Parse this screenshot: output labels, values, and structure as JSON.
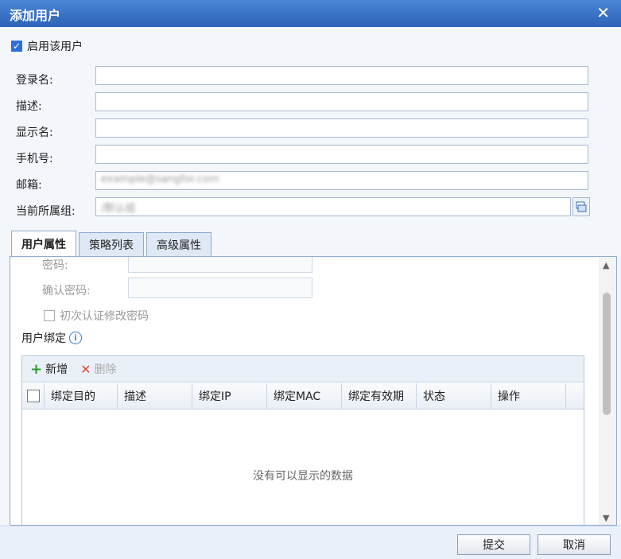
{
  "dialog": {
    "title": "添加用户",
    "close_glyph": "✕"
  },
  "enable_user": {
    "label": "启用该用户",
    "checked": true
  },
  "form": {
    "login_label": "登录名:",
    "login_value": "",
    "desc_label": "描述:",
    "desc_value": "",
    "display_label": "显示名:",
    "display_value": "",
    "phone_label": "手机号:",
    "phone_value": "",
    "email_label": "邮箱:",
    "email_value": "example@sangfor.com",
    "group_label": "当前所属组:",
    "group_value": "/默认组"
  },
  "tabs": [
    {
      "label": "用户属性",
      "active": true
    },
    {
      "label": "策略列表",
      "active": false
    },
    {
      "label": "高级属性",
      "active": false
    }
  ],
  "user_props": {
    "password_label": "密码:",
    "confirm_label": "确认密码:",
    "change_pw_label": "初次认证修改密码",
    "binding_title": "用户绑定",
    "info_glyph": "i"
  },
  "grid": {
    "add_label": "新增",
    "delete_label": "删除",
    "columns": [
      "绑定目的",
      "描述",
      "绑定IP",
      "绑定MAC",
      "绑定有效期",
      "状态",
      "操作"
    ],
    "empty_text": "没有可以显示的数据"
  },
  "footer": {
    "submit_label": "提交",
    "cancel_label": "取消"
  }
}
